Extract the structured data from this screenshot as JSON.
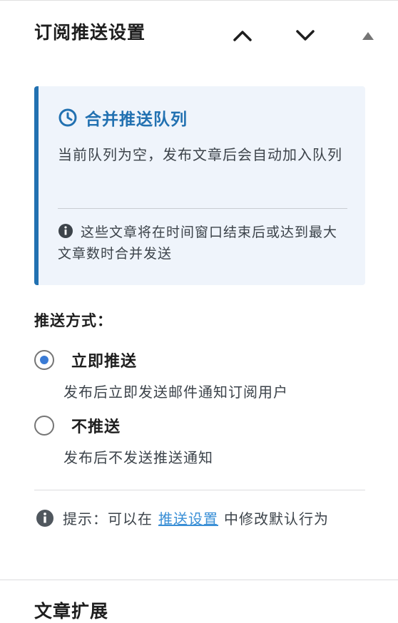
{
  "panel": {
    "title": "订阅推送设置"
  },
  "notice": {
    "title": "合并推送队列",
    "description": "当前队列为空，发布文章后会自动加入队列",
    "info": "这些文章将在时间窗口结束后或达到最大文章数时合并发送"
  },
  "push_method": {
    "label": "推送方式：",
    "options": [
      {
        "label": "立即推送",
        "description": "发布后立即发送邮件通知订阅用户",
        "selected": true
      },
      {
        "label": "不推送",
        "description": "发布后不发送推送通知",
        "selected": false
      }
    ]
  },
  "tip": {
    "prefix": "提示：可以在",
    "link": "推送设置",
    "suffix": "中修改默认行为"
  },
  "next_panel": {
    "title": "文章扩展"
  },
  "colors": {
    "accent": "#2271b1",
    "radio_checked": "#3a7bd5",
    "link": "#3a8fd6",
    "notice_bg": "#eff4fb"
  },
  "icons": {
    "move_up": "chevron-up-icon",
    "move_down": "chevron-down-icon",
    "toggle": "triangle-up-icon",
    "notice": "clock-icon",
    "info": "info-icon"
  }
}
